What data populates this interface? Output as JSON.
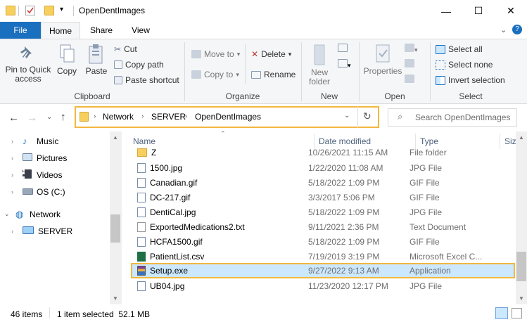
{
  "window": {
    "title": "OpenDentImages",
    "minimize": "—",
    "maximize": "☐",
    "close": "✕"
  },
  "tabs": {
    "file": "File",
    "home": "Home",
    "share": "Share",
    "view": "View"
  },
  "ribbon": {
    "clipboard": {
      "label": "Clipboard",
      "pin": "Pin to Quick\naccess",
      "copy": "Copy",
      "paste": "Paste",
      "cut": "Cut",
      "copy_path": "Copy path",
      "paste_shortcut": "Paste shortcut"
    },
    "organize": {
      "label": "Organize",
      "move_to": "Move to",
      "copy_to": "Copy to",
      "delete": "Delete",
      "rename": "Rename"
    },
    "new": {
      "label": "New",
      "new_folder": "New\nfolder"
    },
    "open": {
      "label": "Open",
      "properties": "Properties"
    },
    "select": {
      "label": "Select",
      "select_all": "Select all",
      "select_none": "Select none",
      "invert": "Invert selection"
    }
  },
  "address": {
    "crumbs": [
      "Network",
      "SERVER",
      "OpenDentImages"
    ],
    "search_placeholder": "Search OpenDentImages"
  },
  "nav": [
    {
      "label": "Music",
      "icon": "music-icon"
    },
    {
      "label": "Pictures",
      "icon": "pictures-icon"
    },
    {
      "label": "Videos",
      "icon": "videos-icon"
    },
    {
      "label": "OS (C:)",
      "icon": "drive-icon"
    },
    {
      "label": "Network",
      "icon": "network-icon"
    },
    {
      "label": "SERVER",
      "icon": "computer-icon"
    }
  ],
  "columns": {
    "name": "Name",
    "date": "Date modified",
    "type": "Type",
    "size": "Siz"
  },
  "files": [
    {
      "name": "Z",
      "date": "10/26/2021 11:15 AM",
      "type": "File folder"
    },
    {
      "name": "1500.jpg",
      "date": "1/22/2020 11:08 AM",
      "type": "JPG File"
    },
    {
      "name": "Canadian.gif",
      "date": "5/18/2022 1:09 PM",
      "type": "GIF File"
    },
    {
      "name": "DC-217.gif",
      "date": "3/3/2017 5:06 PM",
      "type": "GIF File"
    },
    {
      "name": "DentiCal.jpg",
      "date": "5/18/2022 1:09 PM",
      "type": "JPG File"
    },
    {
      "name": "ExportedMedications2.txt",
      "date": "9/11/2021 2:36 PM",
      "type": "Text Document"
    },
    {
      "name": "HCFA1500.gif",
      "date": "5/18/2022 1:09 PM",
      "type": "GIF File"
    },
    {
      "name": "PatientList.csv",
      "date": "7/19/2019 3:19 PM",
      "type": "Microsoft Excel C..."
    },
    {
      "name": "Setup.exe",
      "date": "9/27/2022 9:13 AM",
      "type": "Application"
    },
    {
      "name": "UB04.jpg",
      "date": "11/23/2020 12:17 PM",
      "type": "JPG File"
    }
  ],
  "status": {
    "items": "46 items",
    "selected": "1 item selected  52.1 MB"
  },
  "colors": {
    "accent": "#1a6fbf",
    "highlight": "#f4b73f",
    "selection": "#cce8ff"
  }
}
